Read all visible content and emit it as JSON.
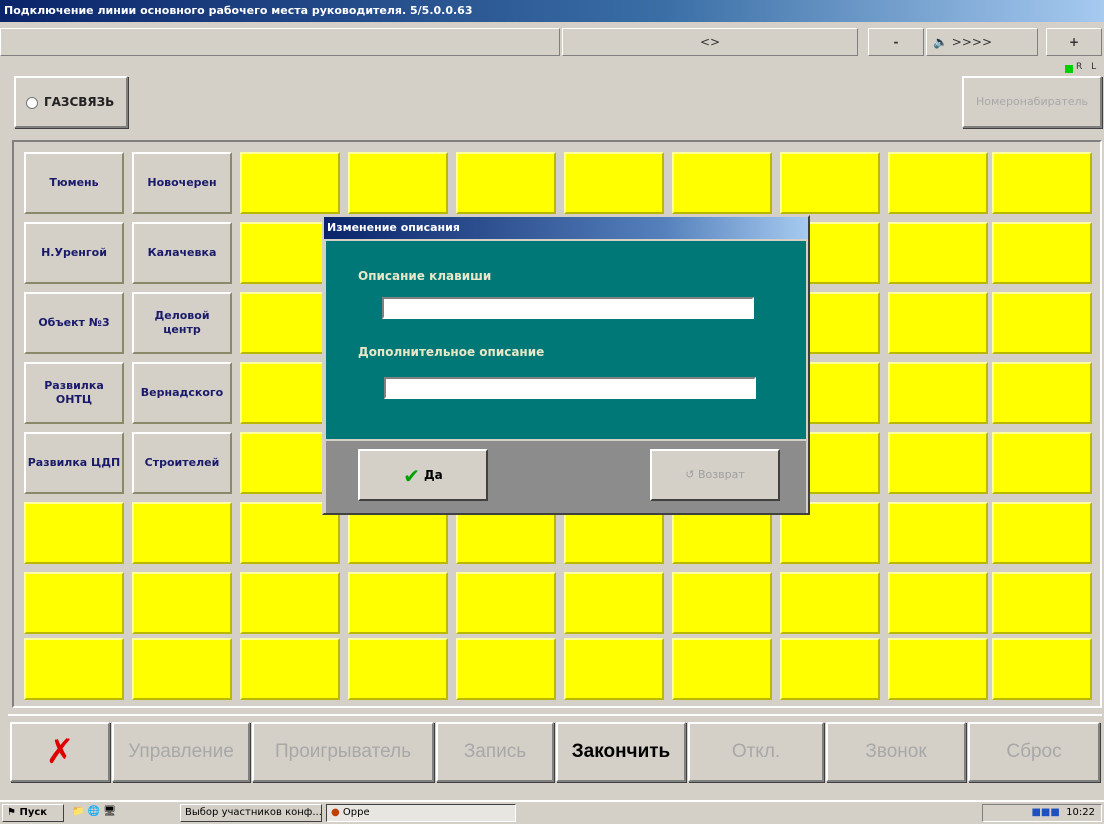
{
  "window": {
    "title": "Подключение линии основного рабочего места руководителя. 5/5.0.0.63"
  },
  "status": {
    "middle": "<>",
    "minus": "-",
    "volume": ">>>>",
    "plus": "+",
    "indicator": "R L"
  },
  "top": {
    "gaz_label": "ГАЗСВЯЗЬ",
    "nomer_label": "Номеронабиратель"
  },
  "grid": {
    "buttons": [
      "Тюмень",
      "Новочерен",
      "Н.Уренгой",
      "Калачевка",
      "Объект №3",
      "Деловой центр",
      "Развилка ОНТЦ",
      "Вернадского",
      "Развилка ЦДП",
      "Строителей"
    ]
  },
  "dialog": {
    "title": "Изменение описания",
    "label1": "Описание клавиши",
    "value1": "",
    "label2": "Дополнительное описание",
    "value2": "",
    "ok": "Да",
    "back": "Возврат"
  },
  "toolbar": {
    "b1": "Управление",
    "b2": "Проигрыватель",
    "b3": "Запись",
    "b4": "Закончить",
    "b5": "Откл.",
    "b6": "Звонок",
    "b7": "Сброс"
  },
  "taskbar": {
    "start": "Пуск",
    "task1": "Выбор участников конф...",
    "task2": "Орре",
    "clock": "10:22"
  },
  "colors": {
    "cell_yellow": "#ffff00",
    "dialog_teal": "#007878"
  }
}
